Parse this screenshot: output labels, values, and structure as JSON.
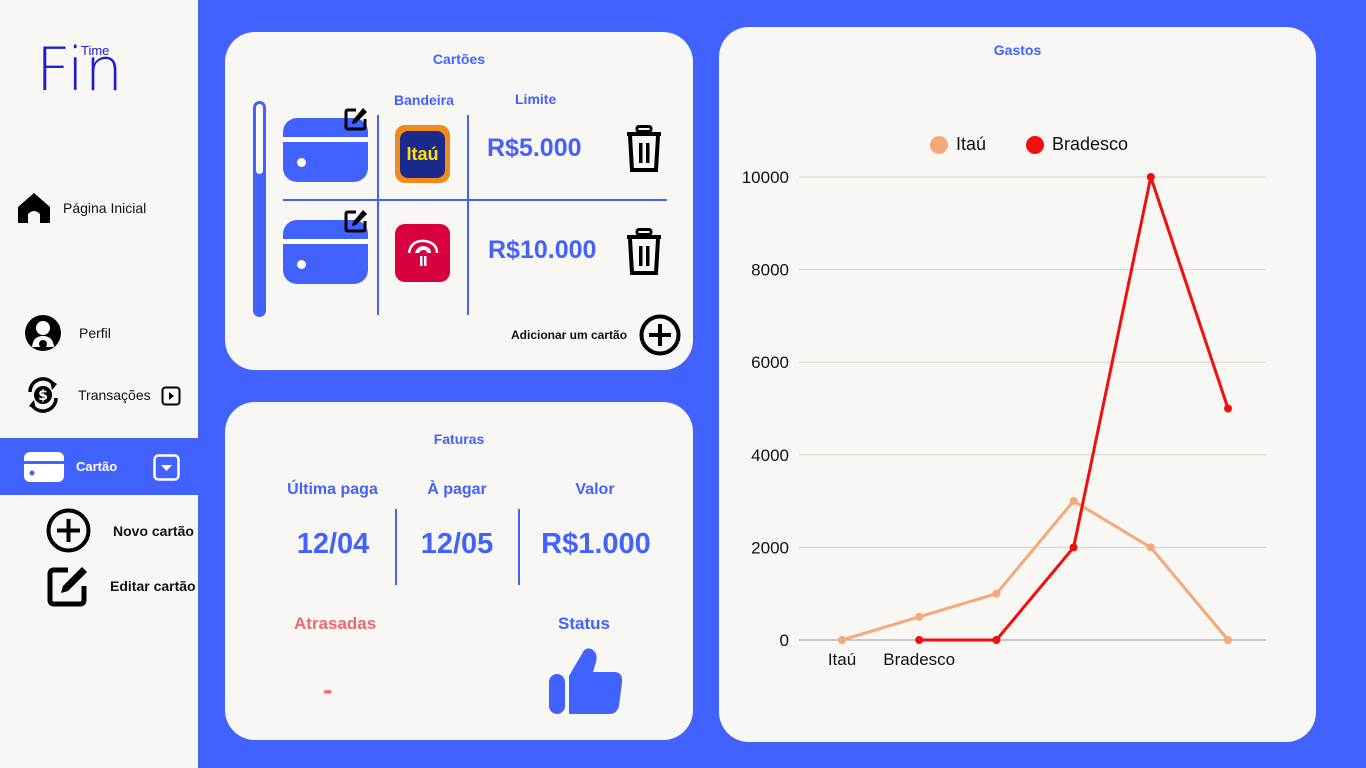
{
  "app": {
    "logo_main": "Fin",
    "logo_sup": "Time"
  },
  "sidebar": {
    "home": "Página Inicial",
    "perfil": "Perfil",
    "transacoes": "Transações",
    "cartao": "Cartão",
    "novo_cartao": "Novo cartão",
    "editar_cartao": "Editar cartão"
  },
  "cartoes": {
    "title": "Cartões",
    "col_bandeira": "Bandeira",
    "col_limite": "Limite",
    "cards": [
      {
        "bank": "Itaú",
        "logo_text": "Itaú",
        "limite": "R$5.000"
      },
      {
        "bank": "Bradesco",
        "limite": "R$10.000"
      }
    ],
    "add_label": "Adicionar um cartão"
  },
  "faturas": {
    "title": "Faturas",
    "col_ultima": "Última paga",
    "col_apagar": "À pagar",
    "col_valor": "Valor",
    "ultima": "12/04",
    "apagar": "12/05",
    "valor": "R$1.000",
    "atrasadas_label": "Atrasadas",
    "atrasadas_value": "-",
    "status_label": "Status",
    "status_icon": "thumbs-up-icon"
  },
  "colors": {
    "primary": "#4262FF",
    "panel": "#F9F7F3",
    "itau": "#F5A878",
    "bradesco": "#F00F0F",
    "overdue": "#F06A6A"
  },
  "chart_data": {
    "type": "line",
    "title": "Gastos",
    "x": [
      "Itaú",
      "Bradesco",
      "",
      "",
      "",
      ""
    ],
    "ylim": [
      0,
      10000
    ],
    "yticks": [
      0,
      2000,
      4000,
      6000,
      8000,
      10000
    ],
    "grid": true,
    "legend_position": "top",
    "series": [
      {
        "name": "Itaú",
        "color": "#F5A878",
        "values": [
          0,
          500,
          1000,
          3000,
          2000,
          0
        ]
      },
      {
        "name": "Bradesco",
        "color": "#F00F0F",
        "values": [
          null,
          0,
          0,
          2000,
          10000,
          5000
        ]
      }
    ]
  }
}
